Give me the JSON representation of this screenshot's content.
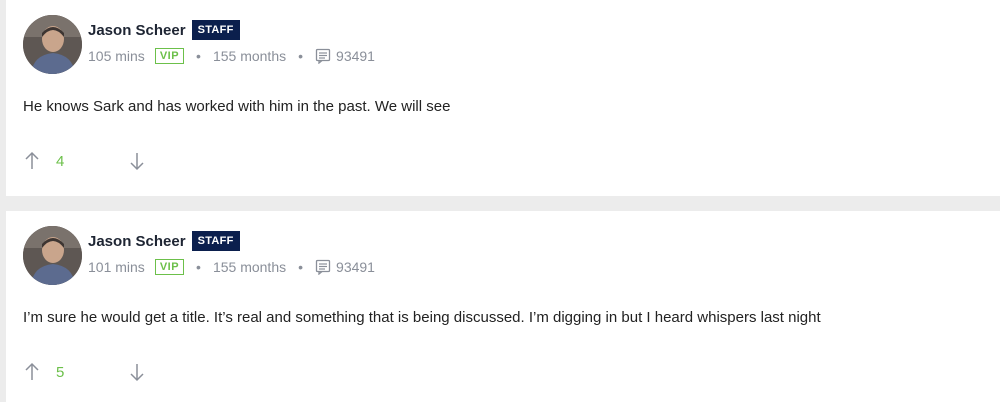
{
  "colors": {
    "staff_badge_bg": "#0b1f4d",
    "vip_green": "#6cc04a",
    "vote_count_green": "#6cc04a",
    "meta_gray": "#8a8f99"
  },
  "comments": [
    {
      "author": "Jason Scheer",
      "staff_badge": "STAFF",
      "time_ago": "105 mins",
      "vip_badge": "VIP",
      "member_duration": "155 months",
      "post_count": "93491",
      "body": "He knows Sark and has worked with him in the past. We will see",
      "vote_count": "4"
    },
    {
      "author": "Jason Scheer",
      "staff_badge": "STAFF",
      "time_ago": "101 mins",
      "vip_badge": "VIP",
      "member_duration": "155 months",
      "post_count": "93491",
      "body": "I’m sure he would get a title. It’s real and something that is being discussed. I’m digging in but I heard whispers last night",
      "vote_count": "5"
    }
  ],
  "icons": {
    "upvote": "arrow-up-icon",
    "downvote": "arrow-down-icon",
    "posts": "message-icon"
  }
}
